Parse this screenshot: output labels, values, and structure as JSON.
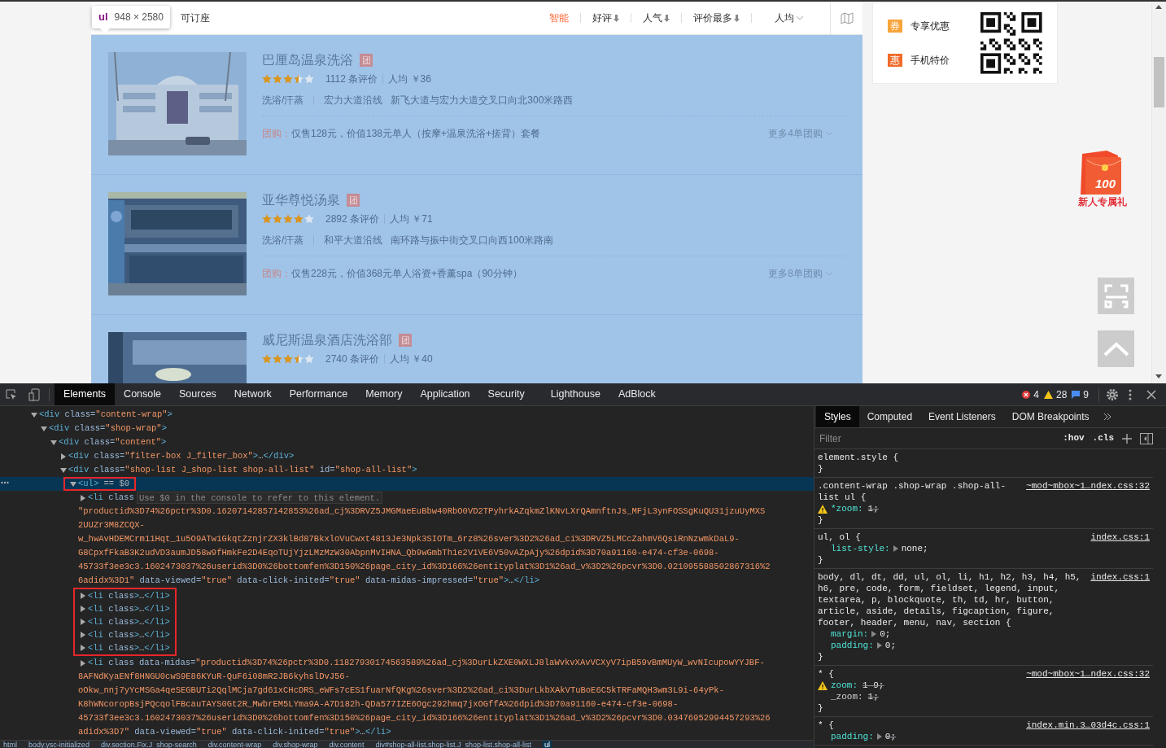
{
  "page": {
    "filter_bar": {
      "tooltip": {
        "tag": "ul",
        "size": "948 × 2580"
      },
      "checkbox_label": "可订座",
      "sorts": [
        {
          "label": "智能",
          "selected": true,
          "kind": "plain"
        },
        {
          "label": "好评",
          "selected": false,
          "kind": "sorted"
        },
        {
          "label": "人气",
          "selected": false,
          "kind": "sorted"
        },
        {
          "label": "评价最多",
          "selected": false,
          "kind": "sorted"
        },
        {
          "label": "人均",
          "selected": false,
          "kind": "dropdown"
        }
      ]
    },
    "shops": [
      {
        "name": "巴厘岛温泉洗浴",
        "tuan": "团",
        "stars": 3.5,
        "reviews": "1112 条评价",
        "price": "人均 ￥36",
        "category": "洗浴/汗蒸",
        "area": "宏力大道沿线",
        "address": "新飞大道与宏力大道交叉口向北300米路西",
        "deal_label": "团购：",
        "deal": "仅售128元，价值138元单人（按摩+温泉洗浴+搓背）套餐",
        "more": "更多4单团购"
      },
      {
        "name": "亚华尊悦汤泉",
        "tuan": "团",
        "stars": 4,
        "reviews": "2892 条评价",
        "price": "人均 ￥71",
        "category": "洗浴/汗蒸",
        "area": "和平大道沿线",
        "address": "南环路与振中街交叉口向西100米路南",
        "deal_label": "团购：",
        "deal": "仅售228元，价值368元单人浴资+香薰spa（90分钟）",
        "more": "更多8单团购"
      },
      {
        "name": "威尼斯温泉酒店洗浴部",
        "tuan": "团",
        "stars": 3.5,
        "reviews": "2740 条评价",
        "price": "人均 ￥40"
      }
    ],
    "promo_card": {
      "items": [
        {
          "badge": "券",
          "label": "专享优惠",
          "color": "#f7a43b"
        },
        {
          "badge": "惠",
          "label": "手机特价",
          "color": "#f06b2a"
        }
      ]
    },
    "gift": {
      "amount": "100",
      "label": "新人专属礼"
    }
  },
  "devtools": {
    "tabs": [
      {
        "label": "Elements",
        "selected": true
      },
      {
        "label": "Console",
        "selected": false
      },
      {
        "label": "Sources",
        "selected": false
      },
      {
        "label": "Network",
        "selected": false
      },
      {
        "label": "Performance",
        "selected": false
      },
      {
        "label": "Memory",
        "selected": false
      },
      {
        "label": "Application",
        "selected": false
      },
      {
        "label": "Security",
        "selected": false
      },
      {
        "label": "Lighthouse",
        "selected": false
      },
      {
        "label": "AdBlock",
        "selected": false
      }
    ],
    "counts": {
      "errors": "4",
      "warnings": "28",
      "messages": "9"
    },
    "dom_tree": [
      {
        "tokens": [
          {
            "kind": "tag",
            "text": "<div"
          },
          {
            "kind": "attr",
            "text": " class="
          },
          {
            "kind": "value",
            "text": "\"content-wrap\""
          },
          {
            "kind": "tag",
            "text": ">"
          }
        ],
        "expanded": true,
        "selected": false,
        "boxed": false,
        "children": [
          {
            "tokens": [
              {
                "kind": "tag",
                "text": "<div"
              },
              {
                "kind": "attr",
                "text": " class="
              },
              {
                "kind": "value",
                "text": "\"shop-wrap\""
              },
              {
                "kind": "tag",
                "text": ">"
              }
            ],
            "expanded": true,
            "selected": false,
            "boxed": false,
            "children": [
              {
                "tokens": [
                  {
                    "kind": "tag",
                    "text": "<div"
                  },
                  {
                    "kind": "attr",
                    "text": " class="
                  },
                  {
                    "kind": "value",
                    "text": "\"content\""
                  },
                  {
                    "kind": "tag",
                    "text": ">"
                  }
                ],
                "expanded": true,
                "selected": false,
                "boxed": false,
                "children": [
                  {
                    "tokens": [
                      {
                        "kind": "tag",
                        "text": "<div"
                      },
                      {
                        "kind": "attr",
                        "text": " class="
                      },
                      {
                        "kind": "value",
                        "text": "\"filter-box J_filter_box\""
                      },
                      {
                        "kind": "tag",
                        "text": ">"
                      },
                      {
                        "kind": "text",
                        "text": "…"
                      },
                      {
                        "kind": "tag",
                        "text": "</div>"
                      }
                    ],
                    "expanded": false,
                    "selected": false,
                    "boxed": false
                  },
                  {
                    "tokens": [
                      {
                        "kind": "tag",
                        "text": "<div"
                      },
                      {
                        "kind": "attr",
                        "text": " class="
                      },
                      {
                        "kind": "value",
                        "text": "\"shop-list J_shop-list shop-all-list\""
                      },
                      {
                        "kind": "attr",
                        "text": " id="
                      },
                      {
                        "kind": "value",
                        "text": "\"shop-all-list\""
                      },
                      {
                        "kind": "tag",
                        "text": ">"
                      }
                    ],
                    "expanded": true,
                    "selected": false,
                    "boxed": false,
                    "children": [
                      {
                        "tokens": [
                          {
                            "kind": "tag",
                            "text": "<ul>"
                          },
                          {
                            "kind": "hint",
                            "text": " == $0"
                          }
                        ],
                        "expanded": true,
                        "selected": true,
                        "boxed": true,
                        "children": [
                          {
                            "tokens": [
                              {
                                "kind": "tag",
                                "text": "<li"
                              },
                              {
                                "kind": "attr",
                                "text": " class"
                              }
                            ],
                            "note": "Use $0 in the console to refer to this element.",
                            "expanded": false,
                            "selected": false,
                            "boxed": false,
                            "wrap": [
                              [
                                {
                                  "kind": "value",
                                  "text": "\"productid%3D74%26pctr%3D0.16207142857142853%26ad_cj%3DRVZ5JMGMaeEuBbw40RbO0VD2TPyhrkAZqkmZlKNvLXrQAmnftnJs_MFjL3ynFOSSgKuQU31jzuUyMXS"
                                }
                              ],
                              [
                                {
                                  "kind": "value",
                                  "text": "2UUZr3M8ZCQX-"
                                }
                              ],
                              [
                                {
                                  "kind": "value",
                                  "text": "w_hwAvHDEMCrm11Hqt_1u5O9ATw1GkqtZznjrZX3klBd87BkxloVuCwxt4813Je3Npk3SIOTm_6rz8%26sver%3D2%26ad_ci%3DRVZ5LMCcZahmV6QsiRnNzwmkDaL9-"
                                }
                              ],
                              [
                                {
                                  "kind": "value",
                                  "text": "G8CpxfFkaB3K2udVD3aumJD58w9fHmkFe2D4EqoTUjYjzLMzMzW30AbpnMvIHNA_Qb9wGmbTh1e2V1VE6V50vAZpAjy%26dpid%3D70a91160-e474-cf3e-0698-"
                                }
                              ],
                              [
                                {
                                  "kind": "value",
                                  "text": "45733f3ee3c3.1602473037%26userid%3D0%26bottomfen%3D150%26page_city_id%3D166%26entityplat%3D1%26ad_v%3D2%26pcvr%3D0.021095588502867316%2"
                                }
                              ],
                              [
                                {
                                  "kind": "value",
                                  "text": "6adidx%3D1\""
                                },
                                {
                                  "kind": "attr",
                                  "text": " data-viewed="
                                },
                                {
                                  "kind": "value",
                                  "text": "\"true\""
                                },
                                {
                                  "kind": "attr",
                                  "text": " data-click-inited="
                                },
                                {
                                  "kind": "value",
                                  "text": "\"true\""
                                },
                                {
                                  "kind": "attr",
                                  "text": " data-midas-impressed="
                                },
                                {
                                  "kind": "value",
                                  "text": "\"true\""
                                },
                                {
                                  "kind": "tag",
                                  "text": ">"
                                },
                                {
                                  "kind": "text",
                                  "text": "…"
                                },
                                {
                                  "kind": "tag",
                                  "text": "</li>"
                                }
                              ]
                            ]
                          },
                          {
                            "tokens": [
                              {
                                "kind": "tag",
                                "text": "<li"
                              },
                              {
                                "kind": "attr",
                                "text": " class"
                              },
                              {
                                "kind": "tag",
                                "text": ">"
                              },
                              {
                                "kind": "text",
                                "text": "…"
                              },
                              {
                                "kind": "tag",
                                "text": "</li>"
                              }
                            ],
                            "expanded": false,
                            "selected": false,
                            "boxed": true
                          },
                          {
                            "tokens": [
                              {
                                "kind": "tag",
                                "text": "<li"
                              },
                              {
                                "kind": "attr",
                                "text": " class"
                              },
                              {
                                "kind": "tag",
                                "text": ">"
                              },
                              {
                                "kind": "text",
                                "text": "…"
                              },
                              {
                                "kind": "tag",
                                "text": "</li>"
                              }
                            ],
                            "expanded": false,
                            "selected": false,
                            "boxed": true
                          },
                          {
                            "tokens": [
                              {
                                "kind": "tag",
                                "text": "<li"
                              },
                              {
                                "kind": "attr",
                                "text": " class"
                              },
                              {
                                "kind": "tag",
                                "text": ">"
                              },
                              {
                                "kind": "text",
                                "text": "…"
                              },
                              {
                                "kind": "tag",
                                "text": "</li>"
                              }
                            ],
                            "expanded": false,
                            "selected": false,
                            "boxed": true
                          },
                          {
                            "tokens": [
                              {
                                "kind": "tag",
                                "text": "<li"
                              },
                              {
                                "kind": "attr",
                                "text": " class"
                              },
                              {
                                "kind": "tag",
                                "text": ">"
                              },
                              {
                                "kind": "text",
                                "text": "…"
                              },
                              {
                                "kind": "tag",
                                "text": "</li>"
                              }
                            ],
                            "expanded": false,
                            "selected": false,
                            "boxed": true
                          },
                          {
                            "tokens": [
                              {
                                "kind": "tag",
                                "text": "<li"
                              },
                              {
                                "kind": "attr",
                                "text": " class"
                              },
                              {
                                "kind": "tag",
                                "text": ">"
                              },
                              {
                                "kind": "text",
                                "text": "…"
                              },
                              {
                                "kind": "tag",
                                "text": "</li>"
                              }
                            ],
                            "expanded": false,
                            "selected": false,
                            "boxed": true
                          },
                          {
                            "tokens": [
                              {
                                "kind": "tag",
                                "text": "<li"
                              },
                              {
                                "kind": "attr",
                                "text": " class data-midas="
                              },
                              {
                                "kind": "value",
                                "text": "\"productid%3D74%26pctr%3D0.11827930174563589%26ad_cj%3DurLkZXE0WXLJ8laWvkvXAvVCXyV7ipB59vBmMUyW_wvNIcupowYYJBF-"
                              }
                            ],
                            "expanded": false,
                            "selected": false,
                            "boxed": false,
                            "wrap": [
                              [
                                {
                                  "kind": "value",
                                  "text": "8AFNdKyaENf8HNGU0cwS9E86KYuR-QuF6i08mR2JB6kyhslDvJ56-"
                                }
                              ],
                              [
                                {
                                  "kind": "value",
                                  "text": "oOkw_nnj7yYcMSGa4qeSEGBUTi2QqlMCja7gd61xCHcDRS_eWFs7cES1fuarNfQKg%26sver%3D2%26ad_ci%3DurLkbXAkVTuBoE6C5kTRFaMQH3wm3L9i-64yPk-"
                                }
                              ],
                              [
                                {
                                  "kind": "value",
                                  "text": "K8hWNcoropBsjPQcqolFBcauTAYS0Gt2R_MwbrEM5LYma9A-A7D182h-QDa577IZE6Ogc292hmq7jxOGffA%26dpid%3D70a91160-e474-cf3e-0698-"
                                }
                              ],
                              [
                                {
                                  "kind": "value",
                                  "text": "45733f3ee3c3.1602473037%26userid%3D0%26bottomfen%3D150%26page_city_id%3D166%26entityplat%3D1%26ad_v%3D2%26pcvr%3D0.03476952994457293%26"
                                }
                              ],
                              [
                                {
                                  "kind": "value",
                                  "text": "adidx%3D7\""
                                },
                                {
                                  "kind": "attr",
                                  "text": " data-viewed="
                                },
                                {
                                  "kind": "value",
                                  "text": "\"true\""
                                },
                                {
                                  "kind": "attr",
                                  "text": " data-click-inited="
                                },
                                {
                                  "kind": "value",
                                  "text": "\"true\""
                                },
                                {
                                  "kind": "tag",
                                  "text": ">"
                                },
                                {
                                  "kind": "text",
                                  "text": "…"
                                },
                                {
                                  "kind": "tag",
                                  "text": "</li>"
                                }
                              ]
                            ]
                          }
                        ]
                      }
                    ]
                  }
                ]
              }
            ]
          }
        ]
      }
    ],
    "sidebar_tabs": [
      {
        "label": "Styles",
        "selected": true
      },
      {
        "label": "Computed",
        "selected": false
      },
      {
        "label": "Event Listeners",
        "selected": false
      },
      {
        "label": "DOM Breakpoints",
        "selected": false
      }
    ],
    "filter": {
      "placeholder": "Filter"
    },
    "toggles": [
      ":hov",
      ".cls"
    ],
    "rules": [
      {
        "selector": "element.style {",
        "close": "}"
      },
      {
        "selector": ".content-wrap .shop-wrap .shop-all-list ul {",
        "source": "~mod~mbox~1…ndex.css:32",
        "close": "}",
        "declarations": [
          {
            "property": "*zoom:",
            "value": "1;",
            "struck": true,
            "warning": true,
            "expandable": false,
            "invalid": false
          }
        ]
      },
      {
        "selector": "ul, ol {",
        "source": "index.css:1",
        "close": "}",
        "declarations": [
          {
            "property": "list-style:",
            "value": "none;",
            "struck": false,
            "warning": false,
            "expandable": true,
            "invalid": false
          }
        ]
      },
      {
        "selector": "body, dl, dt, dd, ul, ol, li, h1, h2, h3, h4, h5, h6, pre, code, form, fieldset, legend, input, textarea, p, blockquote, th, td, hr, button, article, aside, details, figcaption, figure, footer, header, menu, nav, section {",
        "source": "index.css:1",
        "close": "}",
        "declarations": [
          {
            "property": "margin:",
            "value": "0;",
            "struck": false,
            "warning": false,
            "expandable": true,
            "invalid": false
          },
          {
            "property": "padding:",
            "value": "0;",
            "struck": false,
            "warning": false,
            "expandable": true,
            "invalid": false
          }
        ]
      },
      {
        "selector": "* {",
        "source": "~mod~mbox~1…ndex.css:32",
        "close": "}",
        "declarations": [
          {
            "property": "zoom:",
            "value": "1 9;",
            "struck": true,
            "warning": true,
            "expandable": false,
            "invalid": false
          },
          {
            "property": "_zoom:",
            "value": "1;",
            "struck": true,
            "warning": false,
            "expandable": false,
            "invalid": true
          }
        ]
      },
      {
        "selector": "* {",
        "source": "index.min.3…03d4c.css:1",
        "declarations": [
          {
            "property": "padding:",
            "value": "0;",
            "struck": true,
            "warning": false,
            "expandable": true,
            "invalid": false
          }
        ]
      }
    ],
    "breadcrumb": [
      {
        "label": "html",
        "selected": false
      },
      {
        "label": "body.ysc-initialized",
        "selected": false
      },
      {
        "label": "div.section.Fix.J_shop-search",
        "selected": false
      },
      {
        "label": "div.content-wrap",
        "selected": false
      },
      {
        "label": "div.shop-wrap",
        "selected": false
      },
      {
        "label": "div.content",
        "selected": false
      },
      {
        "label": "div#shop-all-list.shop-list.J_shop-list.shop-all-list",
        "selected": false
      },
      {
        "label": "ul",
        "selected": true
      }
    ]
  }
}
